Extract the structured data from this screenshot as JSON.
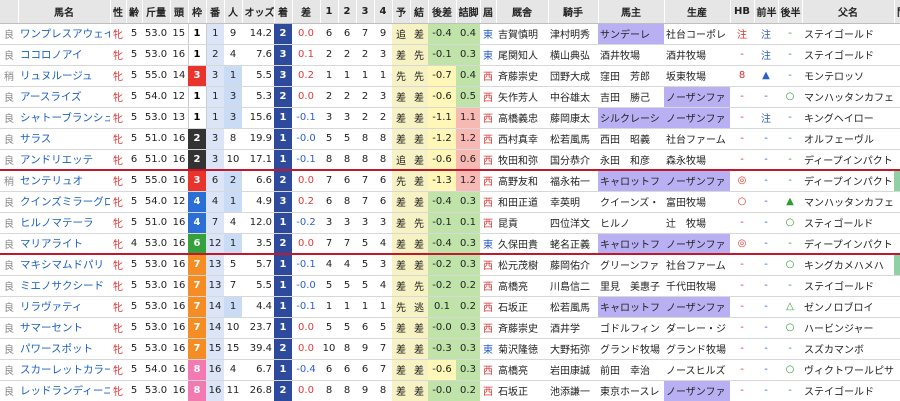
{
  "headers": [
    "",
    "馬名",
    "性",
    "齢",
    "斤量",
    "頭",
    "枠",
    "番",
    "人",
    "オッズ",
    "着",
    "差",
    "1",
    "2",
    "3",
    "4",
    "予",
    "結",
    "後差",
    "詰脚",
    "屆",
    "厩舎",
    "騎手",
    "馬主",
    "生産",
    "HB",
    "前半",
    "後半",
    "父名",
    "間隔"
  ],
  "rows": [
    {
      "baba": "良",
      "name": "ワンプレスアウェイ",
      "sex": "牝",
      "age": "5",
      "kin": "53.0",
      "to": "15",
      "waku": "1",
      "ban": "1",
      "ninki": "9",
      "odds": "14.2",
      "chaku": "2",
      "sa": "0.0",
      "c1": "6",
      "c2": "6",
      "c3": "7",
      "c4": "9",
      "yo": "追",
      "ketsu": "差",
      "kosa": "-0.4",
      "tsume": "0.4",
      "kyu": "東",
      "kyusha": "吉賀慎明",
      "kishu": "津村明秀",
      "banushi": "サンデーレ",
      "seisan": "社台コーポレ",
      "hb": "注",
      "zen": "注",
      "kou": "-",
      "chichi": "ステイゴールド",
      "kankaku": "6"
    },
    {
      "baba": "良",
      "name": "ココロノアイ",
      "sex": "牝",
      "age": "5",
      "kin": "53.0",
      "to": "16",
      "waku": "1",
      "ban": "2",
      "ninki": "4",
      "odds": "7.6",
      "chaku": "3",
      "sa": "0.1",
      "c1": "2",
      "c2": "2",
      "c3": "2",
      "c4": "3",
      "yo": "差",
      "ketsu": "先",
      "kosa": "-0.1",
      "tsume": "0.3",
      "kyu": "東",
      "kyusha": "尾関知人",
      "kishu": "横山典弘",
      "banushi": "酒井牧場",
      "seisan": "酒井牧場",
      "hb": "-",
      "zen": "注",
      "kou": "-",
      "chichi": "ステイゴールド",
      "kankaku": "6"
    },
    {
      "baba": "稍",
      "name": "リュヌルージュ",
      "sex": "牝",
      "age": "5",
      "kin": "55.0",
      "to": "14",
      "waku": "3",
      "ban": "3",
      "ninki": "1",
      "odds": "5.5",
      "chaku": "3",
      "sa": "0.2",
      "c1": "1",
      "c2": "1",
      "c3": "1",
      "c4": "1",
      "yo": "先",
      "ketsu": "先",
      "kosa": "-0.7",
      "tsume": "0.4",
      "kyu": "西",
      "kyusha": "斉藤崇史",
      "kishu": "団野大成",
      "banushi": "窪田　芳郎",
      "seisan": "坂東牧場",
      "hb": "8",
      "zen": "▲",
      "kou": "-",
      "chichi": "モンテロッソ",
      "kankaku": "4"
    },
    {
      "baba": "良",
      "name": "アースライズ",
      "sex": "牝",
      "age": "5",
      "kin": "54.0",
      "to": "12",
      "waku": "1",
      "ban": "1",
      "ninki": "3",
      "odds": "5.3",
      "chaku": "2",
      "sa": "0.0",
      "c1": "2",
      "c2": "2",
      "c3": "2",
      "c4": "3",
      "yo": "差",
      "ketsu": "差",
      "kosa": "-0.6",
      "tsume": "0.5",
      "kyu": "西",
      "kyusha": "矢作芳人",
      "kishu": "中谷雄太",
      "banushi": "吉田　勝己",
      "seisan": "ノーザンファ",
      "hb": "-",
      "zen": "-",
      "kou": "○",
      "chichi": "マンハッタンカフェ",
      "kankaku": "6"
    },
    {
      "baba": "良",
      "name": "シャトーブランシュ",
      "sex": "牝",
      "age": "5",
      "kin": "53.0",
      "to": "13",
      "waku": "1",
      "ban": "1",
      "ninki": "3",
      "odds": "15.6",
      "chaku": "1",
      "sa": "-0.1",
      "c1": "3",
      "c2": "3",
      "c3": "2",
      "c4": "2",
      "yo": "差",
      "ketsu": "差",
      "kosa": "-1.1",
      "tsume": "1.1",
      "kyu": "西",
      "kyusha": "高橋義忠",
      "kishu": "藤岡康太",
      "banushi": "シルクレーシ",
      "seisan": "ノーザンファ",
      "hb": "-",
      "zen": "注",
      "kou": "-",
      "chichi": "キングヘイロー",
      "kankaku": "6"
    },
    {
      "baba": "良",
      "name": "サラス",
      "sex": "牝",
      "age": "5",
      "kin": "51.0",
      "to": "16",
      "waku": "2",
      "ban": "3",
      "ninki": "8",
      "odds": "19.9",
      "chaku": "1",
      "sa": "-0.0",
      "c1": "5",
      "c2": "5",
      "c3": "8",
      "c4": "8",
      "yo": "差",
      "ketsu": "差",
      "kosa": "-1.2",
      "tsume": "1.2",
      "kyu": "西",
      "kyusha": "西村真幸",
      "kishu": "松若風馬",
      "banushi": "西田　昭義",
      "seisan": "社台ファーム",
      "hb": "-",
      "zen": "-",
      "kou": "-",
      "chichi": "オルフェーヴル",
      "kankaku": "5"
    },
    {
      "baba": "良",
      "name": "アンドリエッテ",
      "sex": "牝",
      "age": "6",
      "kin": "51.0",
      "to": "16",
      "waku": "2",
      "ban": "3",
      "ninki": "10",
      "odds": "17.1",
      "chaku": "1",
      "sa": "-0.1",
      "c1": "8",
      "c2": "8",
      "c3": "8",
      "c4": "8",
      "yo": "追",
      "ketsu": "差",
      "kosa": "-0.6",
      "tsume": "0.6",
      "kyu": "西",
      "kyusha": "牧田和弥",
      "kishu": "国分恭介",
      "banushi": "永田　和彦",
      "seisan": "森永牧場",
      "hb": "-",
      "zen": "-",
      "kou": "-",
      "chichi": "ディープインパクト",
      "kankaku": "4",
      "sep": true
    },
    {
      "baba": "稍",
      "name": "センテリュオ",
      "sex": "牝",
      "age": "5",
      "kin": "55.0",
      "to": "16",
      "waku": "3",
      "ban": "6",
      "ninki": "2",
      "odds": "6.6",
      "chaku": "2",
      "sa": "0.0",
      "c1": "7",
      "c2": "6",
      "c3": "7",
      "c4": "6",
      "yo": "先",
      "ketsu": "差",
      "kosa": "-1.3",
      "tsume": "1.2",
      "kyu": "西",
      "kyusha": "高野友和",
      "kishu": "福永祐一",
      "banushi": "キャロットフ",
      "seisan": "ノーザンファ",
      "hb": "◎",
      "zen": "-",
      "kou": "-",
      "chichi": "ディープインパクト",
      "kankaku": "13"
    },
    {
      "baba": "良",
      "name": "クインズミラーグロ",
      "sex": "牝",
      "age": "5",
      "kin": "54.0",
      "to": "12",
      "waku": "4",
      "ban": "4",
      "ninki": "1",
      "odds": "4.9",
      "chaku": "3",
      "sa": "0.2",
      "c1": "6",
      "c2": "8",
      "c3": "7",
      "c4": "6",
      "yo": "差",
      "ketsu": "差",
      "kosa": "-0.4",
      "tsume": "0.3",
      "kyu": "西",
      "kyusha": "和田正道",
      "kishu": "幸英明",
      "banushi": "クイーンズ・",
      "seisan": "富田牧場",
      "hb": "○",
      "zen": "-",
      "kou": "▲",
      "chichi": "マンハッタンカフェ",
      "kankaku": "6"
    },
    {
      "baba": "良",
      "name": "ヒルノマテーラ",
      "sex": "牝",
      "age": "5",
      "kin": "51.0",
      "to": "16",
      "waku": "4",
      "ban": "7",
      "ninki": "4",
      "odds": "12.0",
      "chaku": "1",
      "sa": "-0.2",
      "c1": "3",
      "c2": "3",
      "c3": "3",
      "c4": "3",
      "yo": "差",
      "ketsu": "先",
      "kosa": "-0.1",
      "tsume": "0.1",
      "kyu": "西",
      "kyusha": "昆貢",
      "kishu": "四位洋文",
      "banushi": "ヒルノ",
      "seisan": "辻　牧場",
      "hb": "-",
      "zen": "-",
      "kou": "○",
      "chichi": "スティゴールド",
      "kankaku": "6"
    },
    {
      "baba": "良",
      "name": "マリアライト",
      "sex": "牝",
      "age": "4",
      "kin": "53.0",
      "to": "16",
      "waku": "6",
      "ban": "12",
      "ninki": "1",
      "odds": "3.5",
      "chaku": "2",
      "sa": "0.0",
      "c1": "7",
      "c2": "7",
      "c3": "5",
      "c4": "4",
      "yo": "差",
      "ketsu": "差",
      "kosa": "-0.4",
      "tsume": "0.3",
      "kyu": "東",
      "kyusha": "久保田貴",
      "kishu": "蛯名正義",
      "banushi": "キャロットフ",
      "seisan": "ノーザンファ",
      "hb": "◎",
      "zen": "-",
      "kou": "-",
      "chichi": "ディープインパクト",
      "kankaku": "4",
      "sep": true
    },
    {
      "baba": "良",
      "name": "マキシマムドパリ",
      "sex": "牝",
      "age": "5",
      "kin": "53.0",
      "to": "16",
      "waku": "7",
      "ban": "13",
      "ninki": "5",
      "odds": "5.7",
      "chaku": "1",
      "sa": "-0.1",
      "c1": "4",
      "c2": "4",
      "c3": "5",
      "c4": "3",
      "yo": "差",
      "ketsu": "差",
      "kosa": "-0.2",
      "tsume": "0.3",
      "kyu": "西",
      "kyusha": "松元茂樹",
      "kishu": "藤岡佑介",
      "banushi": "グリーンファ",
      "seisan": "社台ファーム",
      "hb": "-",
      "zen": "-",
      "kou": "○",
      "chichi": "キングカメハメハ",
      "kankaku": "13"
    },
    {
      "baba": "良",
      "name": "ミエノサクシード",
      "sex": "牝",
      "age": "5",
      "kin": "53.0",
      "to": "16",
      "waku": "7",
      "ban": "13",
      "ninki": "7",
      "odds": "5.5",
      "chaku": "1",
      "sa": "-0.0",
      "c1": "5",
      "c2": "5",
      "c3": "5",
      "c4": "4",
      "yo": "差",
      "ketsu": "先",
      "kosa": "-0.2",
      "tsume": "0.2",
      "kyu": "西",
      "kyusha": "高橋亮",
      "kishu": "川島信二",
      "banushi": "里見　美惠子",
      "seisan": "千代田牧場",
      "hb": "-",
      "zen": "-",
      "kou": "-",
      "chichi": "ステイゴールド",
      "kankaku": "6"
    },
    {
      "baba": "良",
      "name": "リラヴァティ",
      "sex": "牝",
      "age": "5",
      "kin": "53.0",
      "to": "16",
      "waku": "7",
      "ban": "14",
      "ninki": "1",
      "odds": "4.4",
      "chaku": "1",
      "sa": "-0.1",
      "c1": "1",
      "c2": "1",
      "c3": "1",
      "c4": "1",
      "yo": "先",
      "ketsu": "逃",
      "kosa": "0.1",
      "tsume": "0.2",
      "kyu": "西",
      "kyusha": "石坂正",
      "kishu": "松若風馬",
      "banushi": "キャロットフ",
      "seisan": "ノーザンファ",
      "hb": "-",
      "zen": "-",
      "kou": "△",
      "chichi": "ゼンノロブロイ",
      "kankaku": "4"
    },
    {
      "baba": "良",
      "name": "サマーセント",
      "sex": "牝",
      "age": "5",
      "kin": "53.0",
      "to": "16",
      "waku": "7",
      "ban": "14",
      "ninki": "10",
      "odds": "23.7",
      "chaku": "1",
      "sa": "0.0",
      "c1": "5",
      "c2": "5",
      "c3": "6",
      "c4": "5",
      "yo": "差",
      "ketsu": "差",
      "kosa": "-0.0",
      "tsume": "0.3",
      "kyu": "西",
      "kyusha": "斉藤崇史",
      "kishu": "酒井学",
      "banushi": "ゴドルフィン",
      "seisan": "ダーレー・ジ",
      "hb": "-",
      "zen": "-",
      "kou": "○",
      "chichi": "ハービンジャー",
      "kankaku": "5"
    },
    {
      "baba": "良",
      "name": "パワースポット",
      "sex": "牝",
      "age": "5",
      "kin": "53.0",
      "to": "16",
      "waku": "7",
      "ban": "15",
      "ninki": "15",
      "odds": "39.4",
      "chaku": "2",
      "sa": "0.0",
      "c1": "10",
      "c2": "8",
      "c3": "9",
      "c4": "7",
      "yo": "差",
      "ketsu": "差",
      "kosa": "-0.3",
      "tsume": "0.3",
      "kyu": "東",
      "kyusha": "菊沢隆徳",
      "kishu": "大野拓弥",
      "banushi": "グランド牧場",
      "seisan": "グランド牧場",
      "hb": "-",
      "zen": "-",
      "kou": "-",
      "chichi": "スズカマンボ",
      "kankaku": "6"
    },
    {
      "baba": "良",
      "name": "スカーレットカラー",
      "sex": "牝",
      "age": "5",
      "kin": "54.0",
      "to": "16",
      "waku": "8",
      "ban": "16",
      "ninki": "4",
      "odds": "6.7",
      "chaku": "1",
      "sa": "-0.4",
      "c1": "6",
      "c2": "6",
      "c3": "6",
      "c4": "7",
      "yo": "差",
      "ketsu": "差",
      "kosa": "-0.6",
      "tsume": "0.3",
      "kyu": "西",
      "kyusha": "高橋亮",
      "kishu": "岩田康誠",
      "banushi": "前田　幸治",
      "seisan": "ノースヒルズ",
      "hb": "-",
      "zen": "-",
      "kou": "○",
      "chichi": "ヴィクトワールピサ",
      "kankaku": "4"
    },
    {
      "baba": "良",
      "name": "レッドランディーニ",
      "sex": "牝",
      "age": "5",
      "kin": "53.0",
      "to": "16",
      "waku": "8",
      "ban": "16",
      "ninki": "11",
      "odds": "26.8",
      "chaku": "2",
      "sa": "0.0",
      "c1": "8",
      "c2": "8",
      "c3": "9",
      "c4": "8",
      "yo": "差",
      "ketsu": "差",
      "kosa": "-0.0",
      "tsume": "0.2",
      "kyu": "西",
      "kyusha": "石坂正",
      "kishu": "池添謙一",
      "banushi": "東京ホースレ",
      "seisan": "ノーザンファ",
      "hb": "-",
      "zen": "-",
      "kou": "-",
      "chichi": "ステイゴールド",
      "kankaku": "4"
    }
  ]
}
